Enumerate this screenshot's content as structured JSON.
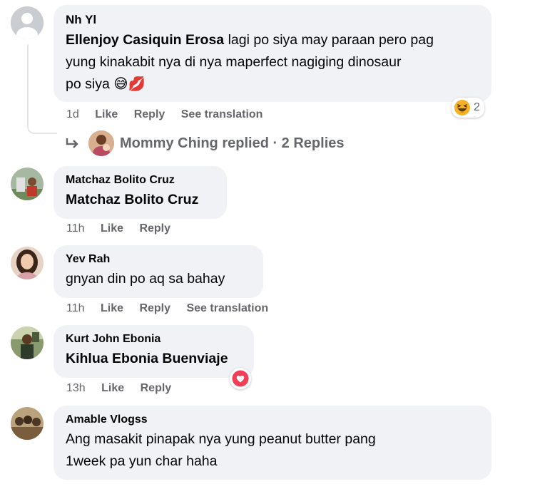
{
  "colors": {
    "bubble": "#f0f2f5",
    "meta": "#65676b",
    "heart": "#f33e58",
    "laugh": "#f7b125"
  },
  "comments": [
    {
      "author": "Nh Yl",
      "mention": "Ellenjoy Casiquin Erosa",
      "line1": " lagi po siya may paraan pero pag",
      "line2": "yung kinakabit nya di nya maperfect nagiging dinosaur",
      "line3": "po siya 😅💋",
      "time": "1d",
      "like": "Like",
      "reply": "Reply",
      "translate": "See translation",
      "reaction_icon": "laughing-emoji-icon",
      "reaction_count": "2",
      "avatar_icon": "default-avatar-icon"
    },
    {
      "author": "Matchaz Bolito Cruz",
      "text": "Matchaz Bolito Cruz",
      "time": "11h",
      "like": "Like",
      "reply": "Reply"
    },
    {
      "author": "Yev Rah",
      "text": "gnyan din po aq sa bahay",
      "time": "11h",
      "like": "Like",
      "reply": "Reply",
      "translate": "See translation"
    },
    {
      "author": "Kurt John Ebonia",
      "text": "Kihlua Ebonia Buenviaje",
      "time": "13h",
      "like": "Like",
      "reply": "Reply",
      "reaction_icon": "heart-reaction-icon"
    },
    {
      "author": "Amable Vlogss",
      "line1": "Ang masakit pinapak nya yung peanut butter pang",
      "line2": "1week pa yun char haha"
    }
  ],
  "replies_link": {
    "text": "Mommy Ching replied · 2 Replies",
    "icon": "reply-arrow-icon"
  }
}
